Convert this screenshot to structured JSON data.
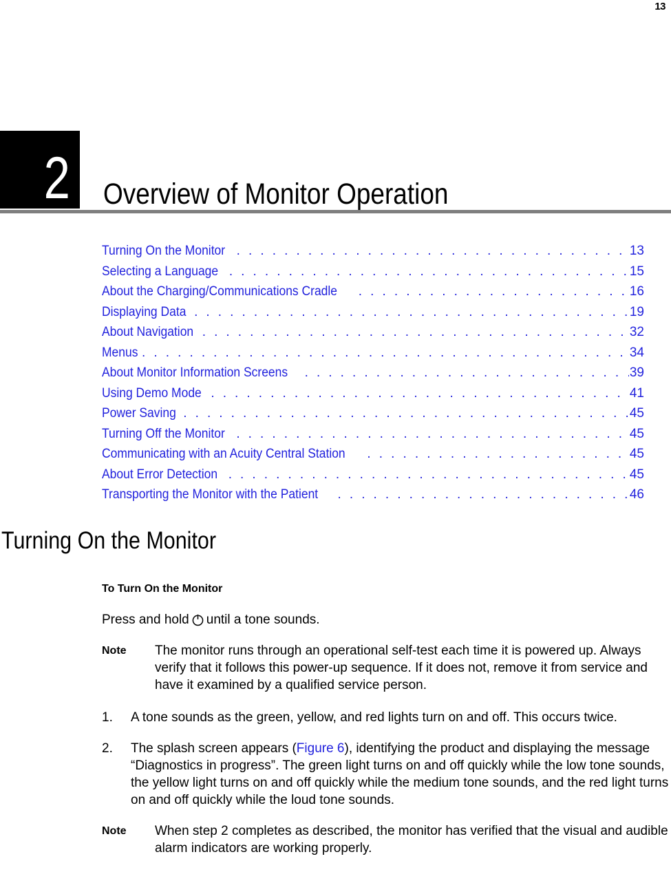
{
  "page": {
    "number": "13"
  },
  "chapter": {
    "number": "2",
    "title": "Overview of Monitor Operation"
  },
  "toc": {
    "entries": [
      {
        "label": "Turning On the Monitor",
        "page": "13"
      },
      {
        "label": "Selecting a Language",
        "page": "15"
      },
      {
        "label": "About the Charging/Communications Cradle",
        "page": "16"
      },
      {
        "label": "Displaying Data",
        "page": "19"
      },
      {
        "label": "About Navigation",
        "page": "32"
      },
      {
        "label": "Menus",
        "page": "34"
      },
      {
        "label": "About Monitor Information Screens",
        "page": "39"
      },
      {
        "label": "Using Demo Mode",
        "page": "41"
      },
      {
        "label": "Power Saving",
        "page": "45"
      },
      {
        "label": "Turning Off the Monitor",
        "page": "45"
      },
      {
        "label": "Communicating with an Acuity Central Station",
        "page": "45"
      },
      {
        "label": "About Error Detection",
        "page": "45"
      },
      {
        "label": "Transporting the Monitor with the Patient",
        "page": "46"
      }
    ]
  },
  "section": {
    "heading": "Turning On the Monitor",
    "subheading": "To Turn On the Monitor",
    "instruction_before_icon": "Press and hold",
    "power_icon_name": "power-icon",
    "instruction_after_icon": "until a tone sounds.",
    "note_1": {
      "label": "Note",
      "text": "The monitor runs through an operational self-test each time it is powered up. Always verify that it follows this power-up sequence. If it does not, remove it from service and have it examined by a qualified service person."
    },
    "steps": [
      {
        "marker": "1.",
        "text": "A tone sounds as the green, yellow, and red lights turn on and off. This occurs twice."
      },
      {
        "marker": "2.",
        "text_before_xref": "The splash screen appears (",
        "xref": "Figure 6",
        "text_after_xref": "), identifying the product and displaying the message “Diagnostics in progress”. The green light turns on and off quickly while the low tone sounds, the yellow light turns on and off quickly while the medium tone sounds, and the red light turns on and off quickly while the loud tone sounds."
      }
    ],
    "note_2": {
      "label": "Note",
      "text": "When step 2 completes as described, the monitor has verified that the visual and audible alarm indicators are working properly."
    }
  },
  "colors": {
    "link_blue": "#2222dd",
    "rule_gray": "#7f7f7f",
    "chapter_block": "#000000"
  }
}
